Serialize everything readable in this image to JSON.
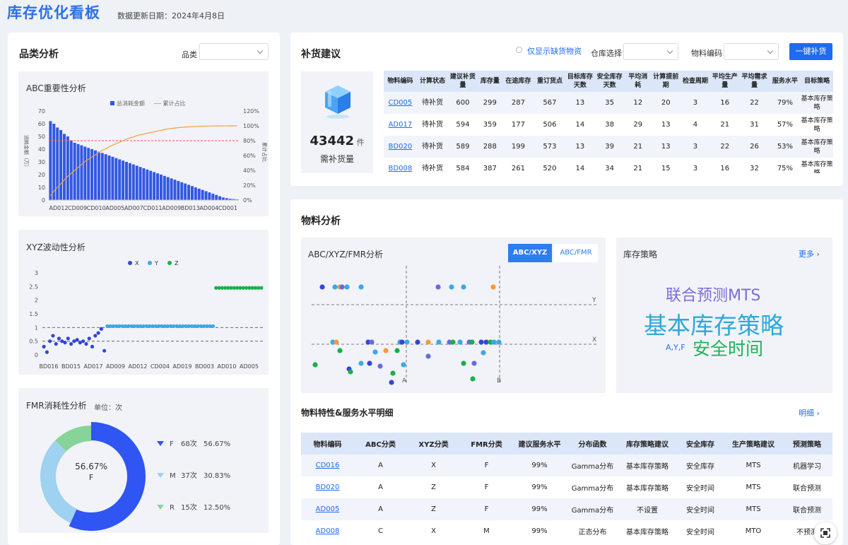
{
  "header": {
    "title": "库存优化看板",
    "update_label": "数据更新日期：2024年4月8日"
  },
  "category": {
    "title": "品类分析",
    "filter_label": "品类",
    "abc": {
      "title": "ABC重要性分析",
      "legend_amount": "总消耗金额",
      "legend_ratio": "累计占比",
      "ylabel_left": "消耗金额（万）",
      "ylabel_right": "累计占比"
    },
    "xyz": {
      "title": "XYZ波动性分析",
      "legend": [
        "X",
        "Y",
        "Z"
      ]
    },
    "fmr": {
      "title": "FMR消耗性分析",
      "unit": "单位：次",
      "center_pct": "56.67%",
      "center_label": "F",
      "items": [
        {
          "k": "F",
          "count": "68次",
          "pct": "56.67%"
        },
        {
          "k": "M",
          "count": "37次",
          "pct": "30.83%"
        },
        {
          "k": "R",
          "count": "15次",
          "pct": "12.50%"
        }
      ]
    }
  },
  "replenish": {
    "title": "补货建议",
    "only_shortage": "仅显示缺货物资",
    "warehouse_label": "仓库选择",
    "code_label": "物料编码",
    "button": "一键补货",
    "kpi_value": "43442",
    "kpi_unit": "件",
    "kpi_label": "需补货量",
    "columns": [
      "物料编码",
      "计算状态",
      "建议补货量",
      "库存量",
      "在途库存",
      "重订货点",
      "目标库存天数",
      "安全库存天数",
      "平均消耗",
      "计算提前期",
      "检查周期",
      "平均生产量",
      "平均需求量",
      "服务水平",
      "目标策略"
    ],
    "rows": [
      [
        "CD005",
        "待补货",
        "600",
        "299",
        "287",
        "567",
        "13",
        "35",
        "12",
        "20",
        "3",
        "16",
        "22",
        "79%",
        "基本库存策略"
      ],
      [
        "AD017",
        "待补货",
        "594",
        "359",
        "177",
        "506",
        "14",
        "38",
        "29",
        "13",
        "4",
        "21",
        "31",
        "57%",
        "基本库存策略"
      ],
      [
        "BD020",
        "待补货",
        "589",
        "288",
        "199",
        "573",
        "13",
        "39",
        "21",
        "13",
        "3",
        "22",
        "26",
        "53%",
        "基本库存策略"
      ],
      [
        "BD008",
        "待补货",
        "584",
        "387",
        "261",
        "520",
        "14",
        "34",
        "21",
        "15",
        "3",
        "16",
        "32",
        "75%",
        "基本库存策略"
      ]
    ]
  },
  "material": {
    "title": "物料分析",
    "scatter_title": "ABC/XYZ/FMR分析",
    "tab1": "ABC/XYZ",
    "tab2": "ABC/FMR",
    "axis_labels": {
      "y": "Y",
      "x": "X",
      "a": "A",
      "b": "B"
    },
    "strategy": {
      "title": "库存策略",
      "more": "更多",
      "words": [
        {
          "t": "联合预测MTS",
          "c": "#7a6cd9"
        },
        {
          "t": "基本库存策略",
          "c": "#2fa8d8"
        },
        {
          "t": "A,Y,F",
          "c": "#2f6fe6"
        },
        {
          "t": "安全时间",
          "c": "#1db45a"
        }
      ]
    },
    "detail": {
      "title": "物料特性&服务水平明细",
      "more": "明细",
      "columns": [
        "物料编码",
        "ABC分类",
        "XYZ分类",
        "FMR分类",
        "建议服务水平",
        "分布函数",
        "库存策略建议",
        "安全库存",
        "生产策略建议",
        "预测策略"
      ],
      "rows": [
        [
          "CD016",
          "A",
          "X",
          "F",
          "99%",
          "Gamma分布",
          "基本库存策略",
          "安全库存",
          "MTS",
          "机器学习"
        ],
        [
          "BD020",
          "A",
          "Z",
          "F",
          "99%",
          "Gamma分布",
          "基本库存策略",
          "安全时间",
          "MTS",
          "联合预测"
        ],
        [
          "AD005",
          "A",
          "Z",
          "F",
          "99%",
          "Gamma分布",
          "不设置",
          "安全时间",
          "MTS",
          "联合预测"
        ],
        [
          "AD008",
          "C",
          "X",
          "M",
          "99%",
          "正态分布",
          "基本库存策略",
          "安全时间",
          "MTO",
          "不预测"
        ]
      ]
    }
  },
  "chart_data": [
    {
      "type": "bar",
      "title": "ABC重要性分析",
      "categories": [
        "AD012",
        "",
        "CD009",
        "",
        "CD010",
        "",
        "AD005",
        "",
        "AD007",
        "",
        "CD011",
        "",
        "AD009",
        "",
        "BD013",
        "",
        "AD004",
        "",
        "CD001",
        ""
      ],
      "x_tick_labels": [
        "AD012",
        "CD009",
        "CD010",
        "AD005",
        "AD007",
        "CD011",
        "AD009",
        "BD013",
        "AD004",
        "CD001"
      ],
      "series": [
        {
          "name": "总消耗金额",
          "values": [
            62,
            60,
            57,
            55,
            52,
            50,
            47,
            45,
            44,
            43,
            42,
            41,
            40,
            39,
            38,
            37,
            36,
            35,
            34,
            33,
            32,
            31,
            30,
            29,
            28,
            27,
            26,
            25,
            24,
            23,
            22,
            21,
            20,
            19,
            18,
            17,
            16,
            15,
            14,
            13,
            12,
            11,
            10,
            9,
            8,
            7,
            6,
            5,
            4,
            3,
            2,
            1.5,
            1,
            0.8,
            0.5
          ]
        },
        {
          "name": "累计占比",
          "type": "line",
          "axis": "right",
          "values": [
            6,
            12,
            17,
            22,
            27,
            32,
            36,
            40,
            44,
            48,
            52,
            55,
            58,
            61,
            64,
            67,
            69,
            72,
            74,
            76,
            78,
            80,
            82,
            84,
            85,
            87,
            88,
            89,
            90,
            91,
            92,
            93,
            94,
            95,
            96,
            96.5,
            97,
            97.5,
            98,
            98.3,
            98.6,
            98.9,
            99.1,
            99.3,
            99.5,
            99.6,
            99.7,
            99.8,
            99.85,
            99.9,
            99.93,
            99.95,
            99.97,
            99.99,
            100
          ]
        }
      ],
      "y_ticks": [
        "0",
        "10",
        "20",
        "30",
        "40",
        "50",
        "60",
        "70"
      ],
      "y_right_ticks": [
        "0%",
        "20%",
        "40%",
        "60%",
        "80%",
        "100%",
        "120%"
      ],
      "ylim": [
        0,
        70
      ],
      "ylim_right": [
        0,
        120
      ],
      "reference_line": 80
    },
    {
      "type": "scatter",
      "title": "XYZ波动性分析",
      "x_tick_labels": [
        "BD016",
        "BD015",
        "AD017",
        "AD009",
        "AD012",
        "CD004",
        "AD019",
        "BD003",
        "AD010",
        "AD005"
      ],
      "y_ticks": [
        "0",
        "0.5",
        "1",
        "1.5",
        "2",
        "2.5",
        "3"
      ],
      "ylim": [
        0,
        3
      ],
      "reference_lines": [
        0.5,
        1
      ],
      "series": [
        {
          "name": "X",
          "values": [
            0.3,
            0.1,
            0.5,
            0.7,
            0.4,
            0.6,
            0.5,
            0.45,
            0.6,
            0.4,
            0.5,
            0.55,
            0.45,
            0.5,
            0.4,
            0.6,
            0.3,
            0.7,
            0.8,
            0.95,
            0.15
          ]
        },
        {
          "name": "Y",
          "values": [
            1.05,
            1.05,
            1.05,
            1.05,
            1.05,
            1.05,
            1.05,
            1.05,
            1.05,
            1.05,
            1.05,
            1.05,
            1.05,
            1.05,
            1.05,
            1.05,
            1.05,
            1.05,
            1.05,
            1.05,
            1.05,
            1.05,
            1.05,
            1.05,
            1.05,
            1.05,
            1.05,
            1.05,
            1.05,
            1.05,
            1.05,
            1.05,
            1.05,
            1.05,
            1.05,
            1.05
          ]
        },
        {
          "name": "Z",
          "values": [
            2.45,
            2.45,
            2.45,
            2.45,
            2.45,
            2.45,
            2.45,
            2.45,
            2.45,
            2.45,
            2.45,
            2.45,
            2.45,
            2.45,
            2.45,
            2.45
          ]
        }
      ]
    },
    {
      "type": "pie",
      "title": "FMR消耗性分析",
      "categories": [
        "F",
        "M",
        "R"
      ],
      "values": [
        68,
        37,
        15
      ]
    }
  ]
}
